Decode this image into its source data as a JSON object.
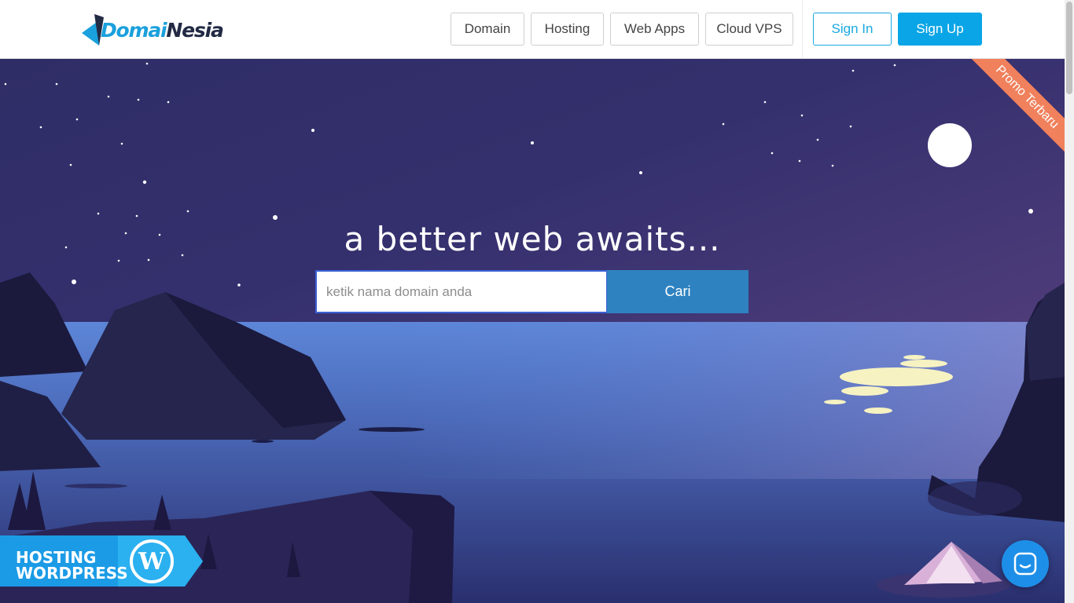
{
  "header": {
    "logo_text_a": "Domai",
    "logo_text_b": "Nesia",
    "nav": [
      "Domain",
      "Hosting",
      "Web Apps",
      "Cloud VPS"
    ],
    "sign_in": "Sign In",
    "sign_up": "Sign Up"
  },
  "hero": {
    "tagline": "a better web awaits...",
    "search_placeholder": "ketik nama domain anda",
    "search_button": "Cari",
    "ribbon": "Promo Terbaru"
  },
  "promo": {
    "line1": "HOSTING",
    "line2": "WORDPRESS"
  },
  "icons": {
    "logo": "domainesia-logo-icon",
    "wordpress": "wordpress-icon",
    "chat": "chat-icon"
  },
  "colors": {
    "brand_blue": "#0aa5e6",
    "search_button": "#2f82c0",
    "ribbon": "#f0815c"
  }
}
